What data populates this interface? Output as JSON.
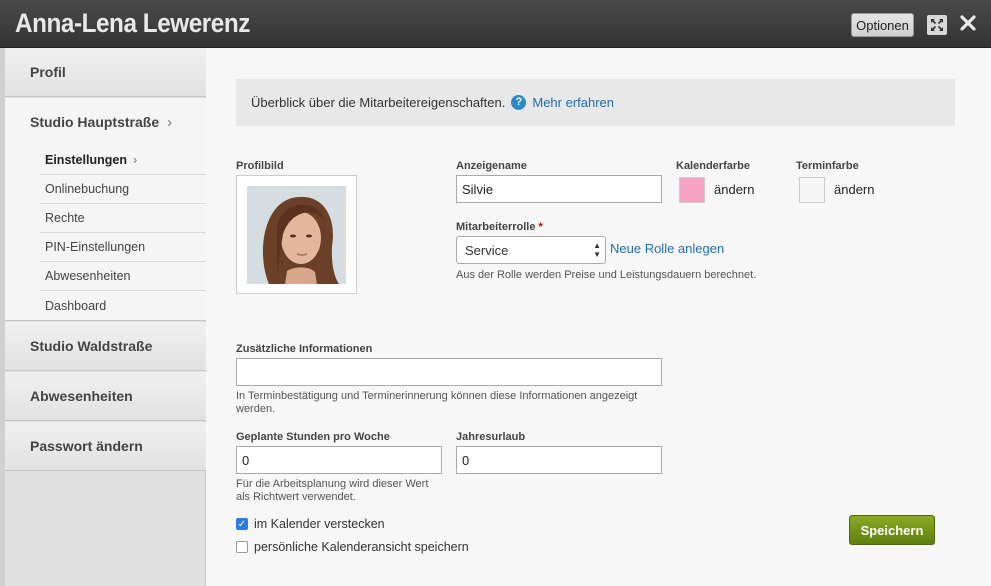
{
  "window": {
    "title": "Anna-Lena Lewerenz",
    "options_label": "Optionen"
  },
  "sidebar": {
    "sections": [
      {
        "label": "Profil"
      },
      {
        "label": "Studio Hauptstraße"
      },
      {
        "label": "Studio Waldstraße"
      },
      {
        "label": "Abwesenheiten"
      },
      {
        "label": "Passwort ändern"
      }
    ],
    "sub_items": [
      {
        "label": "Einstellungen"
      },
      {
        "label": "Onlinebuchung"
      },
      {
        "label": "Rechte"
      },
      {
        "label": "PIN-Einstellungen"
      },
      {
        "label": "Abwesenheiten"
      },
      {
        "label": "Dashboard"
      }
    ]
  },
  "main": {
    "info_text": "Überblick über die Mitarbeitereigenschaften.",
    "info_link": "Mehr erfahren",
    "profilbild_label": "Profilbild",
    "anzeigename_label": "Anzeigename",
    "anzeigename_value": "Silvie",
    "kalenderfarbe_label": "Kalenderfarbe",
    "kalenderfarbe_color": "#f7a3c3",
    "terminfarbe_label": "Terminfarbe",
    "terminfarbe_color": "#f5f5f5",
    "aendern_label": "ändern",
    "rolle_label": "Mitarbeiterrolle",
    "rolle_required": "*",
    "rolle_value": "Service",
    "neue_rolle_link": "Neue Rolle anlegen",
    "rolle_hint": "Aus der Rolle werden Preise und Leistungsdauern berechnet.",
    "zusatz_label": "Zusätzliche Informationen",
    "zusatz_value": "",
    "zusatz_hint_1": "In Terminbestätigung und Terminerinnerung können diese Informationen angezeigt",
    "zusatz_hint_2": "werden.",
    "stunden_label": "Geplante Stunden pro Woche",
    "stunden_value": "0",
    "stunden_hint_1": "Für die Arbeitsplanung wird dieser Wert",
    "stunden_hint_2": "als Richtwert verwendet.",
    "urlaub_label": "Jahresurlaub",
    "urlaub_value": "0",
    "cb_kalender_label": "im Kalender verstecken",
    "cb_kalender_checked": true,
    "cb_ansicht_label": "persönliche Kalenderansicht speichern",
    "cb_ansicht_checked": false,
    "save_label": "Speichern"
  }
}
